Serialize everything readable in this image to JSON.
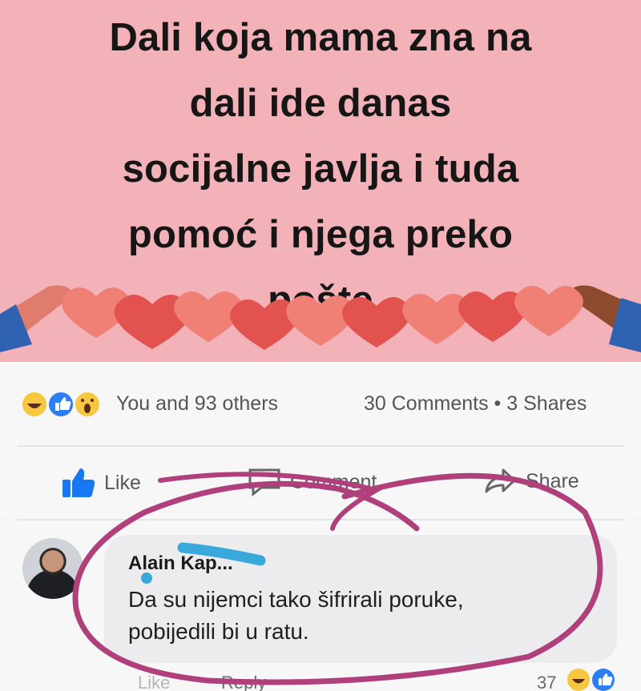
{
  "post": {
    "image_text": "Dali koja mama zna na\ndali ide danas\nsocijalne javlja i tuda\npomoć i njega preko\npošte"
  },
  "stats": {
    "reactions_label": "You and 93 others",
    "counts_label": "30 Comments • 3 Shares"
  },
  "actions": {
    "like": "Like",
    "comment": "Comment",
    "share": "Share"
  },
  "comment": {
    "author": "Alain Kap...",
    "text": "Da su nijemci tako šifrirali poruke,\npobijedili bi u ratu.",
    "like_label": "Like",
    "reply_label": "Reply",
    "reaction_count": "37"
  },
  "colors": {
    "banner_bg": "#f3b1b8",
    "heart": "#e2534f",
    "facebook_blue": "#1877f2",
    "annotation": "#b0407c",
    "redaction": "#39a9dc"
  }
}
